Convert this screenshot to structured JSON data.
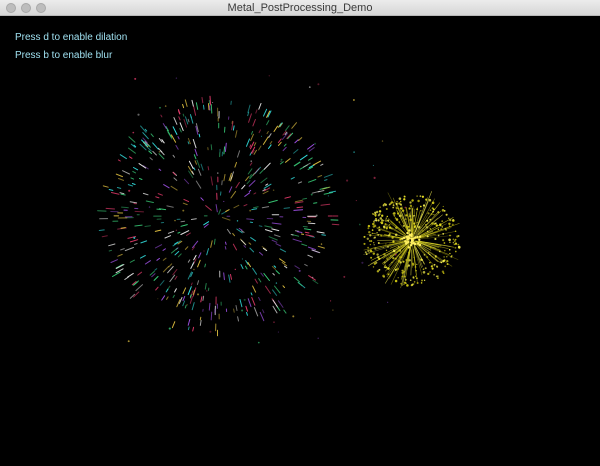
{
  "window": {
    "title": "Metal_PostProcessing_Demo"
  },
  "hints": {
    "dilation": "Press d to enable dilation",
    "blur": "Press b to enable blur"
  },
  "fireworks": [
    {
      "name": "multicolor-burst",
      "colors": [
        "#33e0e0",
        "#e23a6a",
        "#9b4fe0",
        "#f2f2f2",
        "#3ad07a",
        "#e0c040"
      ]
    },
    {
      "name": "yellow-burst",
      "colors": [
        "#e8e020",
        "#f4ee50",
        "#c8c010"
      ]
    }
  ]
}
